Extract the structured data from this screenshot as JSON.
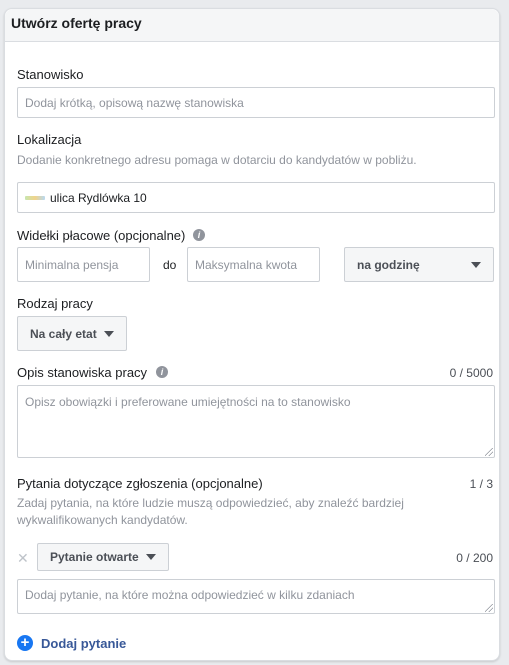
{
  "card": {
    "title": "Utwórz ofertę pracy"
  },
  "position": {
    "label": "Stanowisko",
    "placeholder": "Dodaj krótką, opisową nazwę stanowiska"
  },
  "location": {
    "label": "Lokalizacja",
    "hint": "Dodanie konkretnego adresu pomaga w dotarciu do kandydatów w pobliżu.",
    "value": "ulica Rydlówka 10"
  },
  "salary": {
    "label": "Widełki płacowe (opcjonalne)",
    "min_placeholder": "Minimalna pensja",
    "separator": "do",
    "max_placeholder": "Maksymalna kwota",
    "period": "na godzinę"
  },
  "job_type": {
    "label": "Rodzaj pracy",
    "value": "Na cały etat"
  },
  "description": {
    "label": "Opis stanowiska pracy",
    "counter": "0 / 5000",
    "placeholder": "Opisz obowiązki i preferowane umiejętności na to stanowisko"
  },
  "questions": {
    "label": "Pytania dotyczące zgłoszenia (opcjonalne)",
    "counter": "1 / 3",
    "hint": "Zadaj pytania, na które ludzie muszą odpowiedzieć, aby znaleźć bardziej wykwalifikowanych kandydatów.",
    "item": {
      "type": "Pytanie otwarte",
      "counter": "0 / 200",
      "placeholder": "Dodaj pytanie, na które można odpowiedzieć w kilku zdaniach"
    },
    "add_label": "Dodaj pytanie"
  },
  "colors": {
    "accent": "#1877f2",
    "link": "#385898",
    "border": "#ccd0d5"
  }
}
